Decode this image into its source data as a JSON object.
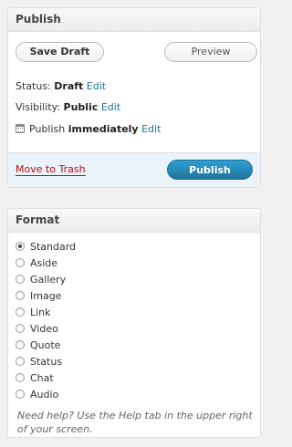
{
  "publish": {
    "title": "Publish",
    "save_draft_label": "Save Draft",
    "preview_label": "Preview",
    "status_label": "Status:",
    "status_value": "Draft",
    "visibility_label": "Visibility:",
    "visibility_value": "Public",
    "publish_label": "Publish",
    "publish_value": "immediately",
    "edit_label": "Edit",
    "trash_label": "Move to Trash",
    "publish_button_label": "Publish",
    "colors": {
      "accent": "#21759b",
      "trash": "#bc0b0b",
      "footer_bg": "#eaf2fa"
    }
  },
  "format": {
    "title": "Format",
    "selected": "Standard",
    "options": [
      "Standard",
      "Aside",
      "Gallery",
      "Image",
      "Link",
      "Video",
      "Quote",
      "Status",
      "Chat",
      "Audio"
    ],
    "help_text": "Need help? Use the Help tab in the upper right of your screen."
  }
}
